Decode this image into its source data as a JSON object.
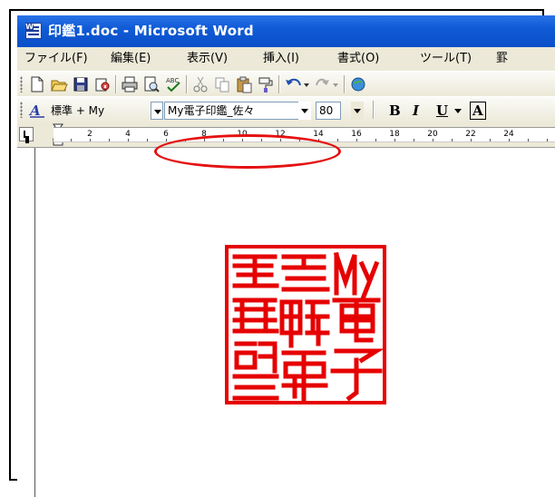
{
  "window": {
    "title": "印鑑1.doc - Microsoft Word"
  },
  "menu": {
    "items": [
      "ファイル(F)",
      "編集(E)",
      "表示(V)",
      "挿入(I)",
      "書式(O)",
      "ツール(T)",
      "罫"
    ]
  },
  "format_toolbar": {
    "style_value": "標準 + My",
    "font_value": "My電子印鑑_佐々",
    "size_value": "80",
    "bold_label": "B",
    "italic_label": "I",
    "underline_label": "U",
    "char_border_label": "A"
  },
  "ruler": {
    "numbers": [
      "2",
      "4",
      "6",
      "8",
      "10",
      "12",
      "14",
      "16",
      "18",
      "20",
      "22",
      "24"
    ]
  },
  "document": {
    "seal_text": "My電子印鑑",
    "seal_color": "#e60000"
  },
  "colors": {
    "title_bar": "#0a4fc7",
    "toolbar_bg": "#ece9d8",
    "annotation": "#e51010"
  },
  "icons": [
    "word-doc-icon",
    "new-icon",
    "open-icon",
    "save-icon",
    "permission-icon",
    "print-icon",
    "print-preview-icon",
    "spelling-icon",
    "cut-icon",
    "copy-icon",
    "paste-icon",
    "format-painter-icon",
    "undo-icon",
    "redo-icon",
    "hyperlink-icon",
    "styles-icon"
  ]
}
